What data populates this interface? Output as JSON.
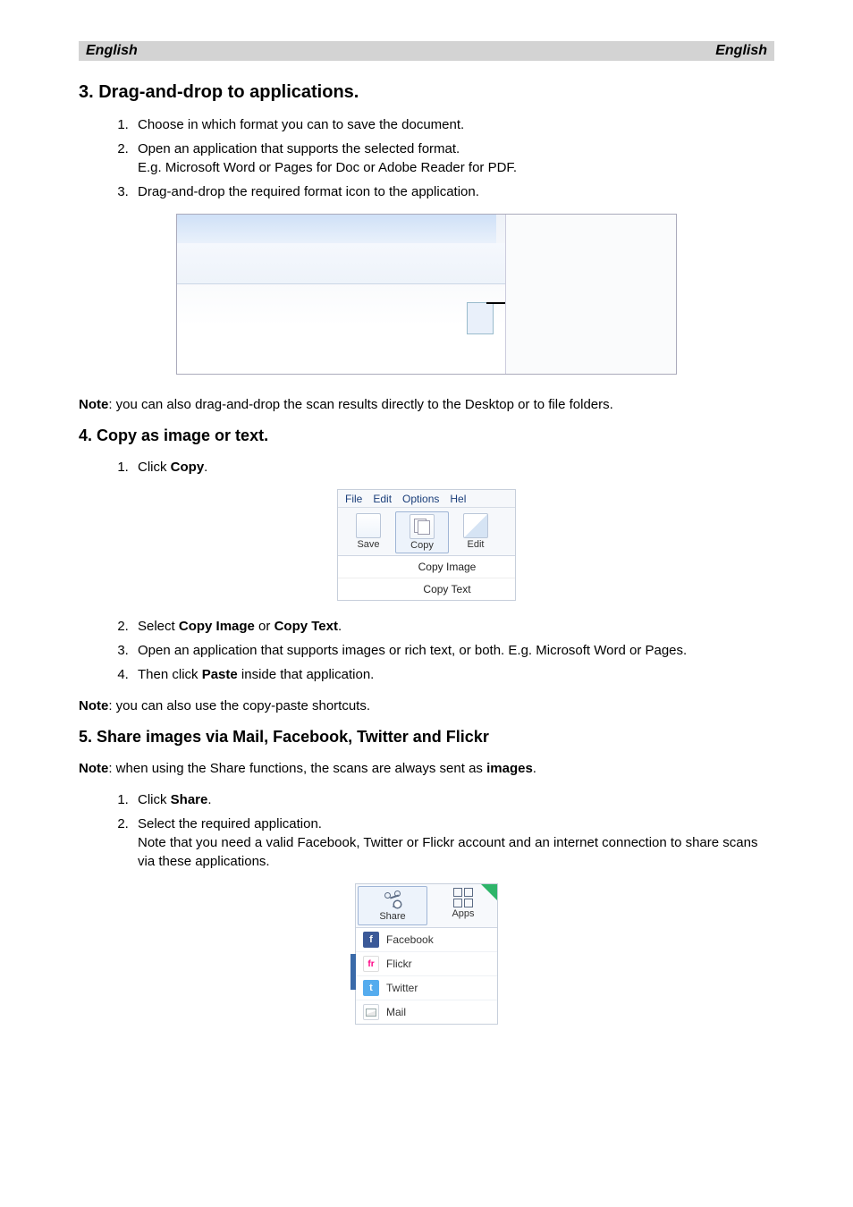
{
  "header": {
    "left": "English",
    "right": "English"
  },
  "s3": {
    "title": "3. Drag-and-drop to applications.",
    "steps": [
      "Choose in which format you can to save the document.",
      "Open an application that supports the selected format.\nE.g. Microsoft Word or Pages for Doc or Adobe Reader for PDF.",
      "Drag-and-drop the required format icon to the application."
    ],
    "note_label": "Note",
    "note_text": ": you can also drag-and-drop the scan results directly to the Desktop or to file folders."
  },
  "s4": {
    "title": "4. Copy as image or text.",
    "steps_a": {
      "pre": "Click ",
      "bold": "Copy",
      "post": "."
    },
    "copyui": {
      "menu": [
        "File",
        "Edit",
        "Options",
        "Hel"
      ],
      "buttons": [
        "Save",
        "Copy",
        "Edit"
      ],
      "dropdown": [
        "Copy Image",
        "Copy Text"
      ]
    },
    "step2": {
      "pre": "Select ",
      "b1": "Copy Image",
      "mid": " or ",
      "b2": "Copy Text",
      "post": "."
    },
    "step3": "Open an application that supports images or rich text, or both. E.g. Microsoft Word or Pages.",
    "step4": {
      "pre": "Then click ",
      "bold": "Paste",
      "post": " inside that application."
    },
    "note_label": "Note",
    "note_text": ": you can also use the copy-paste shortcuts."
  },
  "s5": {
    "title": "5. Share images via Mail, Facebook, Twitter and Flickr",
    "note_label": "Note",
    "note_pre": ": when using the Share functions, the scans are always sent as ",
    "note_bold": "images",
    "note_post": ".",
    "step1": {
      "pre": "Click ",
      "bold": "Share",
      "post": "."
    },
    "step2": "Select the required application.\nNote that you need a valid Facebook, Twitter or Flickr account and an internet connection to share scans via these applications.",
    "shareui": {
      "buttons": [
        "Share",
        "Apps"
      ],
      "items": [
        "Facebook",
        "Flickr",
        "Twitter",
        "Mail"
      ]
    }
  }
}
